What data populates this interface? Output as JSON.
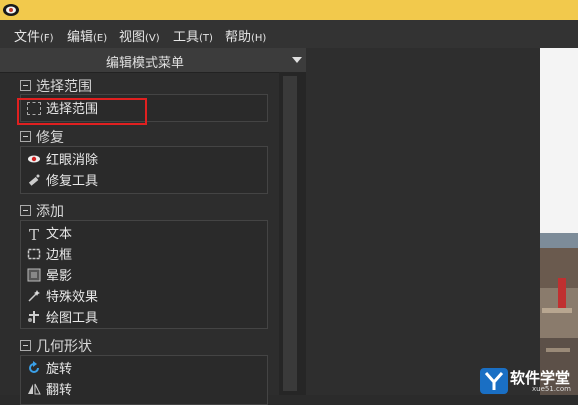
{
  "menubar": {
    "items": [
      {
        "label": "文件",
        "accel": "(F)"
      },
      {
        "label": "编辑",
        "accel": "(E)"
      },
      {
        "label": "视图",
        "accel": "(V)"
      },
      {
        "label": "工具",
        "accel": "(T)"
      },
      {
        "label": "帮助",
        "accel": "(H)"
      }
    ]
  },
  "panel": {
    "title": "编辑模式菜单",
    "sections": [
      {
        "title": "选择范围",
        "items": [
          {
            "label": "选择范围",
            "icon": "selection-icon"
          }
        ]
      },
      {
        "title": "修复",
        "items": [
          {
            "label": "红眼消除",
            "icon": "red-eye-icon"
          },
          {
            "label": "修复工具",
            "icon": "repair-icon"
          }
        ]
      },
      {
        "title": "添加",
        "items": [
          {
            "label": "文本",
            "icon": "text-icon"
          },
          {
            "label": "边框",
            "icon": "frame-icon"
          },
          {
            "label": "晕影",
            "icon": "vignette-icon"
          },
          {
            "label": "特殊效果",
            "icon": "magic-wand-icon"
          },
          {
            "label": "绘图工具",
            "icon": "drawing-tools-icon"
          }
        ]
      },
      {
        "title": "几何形状",
        "items": [
          {
            "label": "旋转",
            "icon": "rotate-icon"
          },
          {
            "label": "翻转",
            "icon": "flip-icon"
          }
        ]
      }
    ]
  },
  "watermark": {
    "text": "软件学堂",
    "sub": "xue51.com"
  },
  "colors": {
    "titlebar": "#f2c94c",
    "highlight": "#e02020"
  }
}
